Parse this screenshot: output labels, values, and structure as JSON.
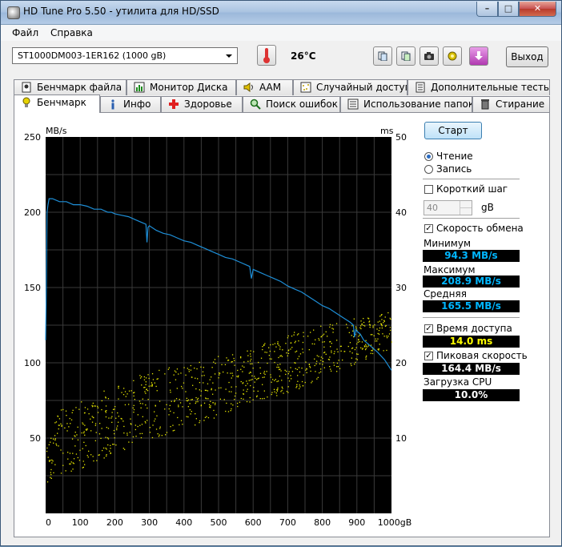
{
  "window": {
    "title": "HD Tune Pro 5.50 - утилита для HD/SSD"
  },
  "menu": [
    {
      "label": "Файл"
    },
    {
      "label": "Справка"
    }
  ],
  "toolbar": {
    "drive": "ST1000DM003-1ER162 (1000 gB)",
    "temperature": "26°C",
    "exit_label": "Выход"
  },
  "tabs_top": [
    {
      "label": "Бенчмарк файла",
      "icon": "file-benchmark-icon"
    },
    {
      "label": "Монитор Диска",
      "icon": "disk-monitor-icon"
    },
    {
      "label": "AAM",
      "icon": "speaker-icon"
    },
    {
      "label": "Случайный доступ",
      "icon": "random-access-icon"
    },
    {
      "label": "Дополнительные  тесты",
      "icon": "extra-tests-icon"
    }
  ],
  "tabs_bottom": [
    {
      "label": "Бенчмарк",
      "icon": "benchmark-icon",
      "active": true
    },
    {
      "label": "Инфо",
      "icon": "info-icon"
    },
    {
      "label": "Здоровье",
      "icon": "health-icon"
    },
    {
      "label": "Поиск ошибок",
      "icon": "error-scan-icon"
    },
    {
      "label": "Использование папок",
      "icon": "folder-usage-icon"
    },
    {
      "label": "Стирание",
      "icon": "erase-icon"
    }
  ],
  "side": {
    "start_label": "Старт",
    "read_label": "Чтение",
    "write_label": "Запись",
    "short_stroke_label": "Короткий шаг",
    "short_stroke_value": "40",
    "short_stroke_unit": "gB",
    "transfer_rate_label": "Скорость обмена",
    "min_label": "Минимум",
    "min_value": "94.3 MB/s",
    "max_label": "Максимум",
    "max_value": "208.9 MB/s",
    "avg_label": "Средняя",
    "avg_value": "165.5 MB/s",
    "access_time_label": "Время доступа",
    "access_time_value": "14.0 ms",
    "burst_label": "Пиковая скорость",
    "burst_value": "164.4 MB/s",
    "cpu_label": "Загрузка CPU",
    "cpu_value": "10.0%"
  },
  "chart_data": {
    "type": "line",
    "y_left_unit": "MB/s",
    "y_right_unit": "ms",
    "y_left_ticks": [
      "50",
      "100",
      "150",
      "200",
      "250"
    ],
    "y_right_ticks": [
      "10",
      "20",
      "30",
      "40",
      "50"
    ],
    "x_ticks": [
      "0",
      "100",
      "200",
      "300",
      "400",
      "500",
      "600",
      "700",
      "800",
      "900",
      "1000gB"
    ],
    "xlim": [
      0,
      1000
    ],
    "ylim_left": [
      0,
      250
    ],
    "ylim_right": [
      0,
      50
    ],
    "colors": {
      "background": "#000000",
      "grid": "#3a3a3a",
      "transfer": "#1e8fd8",
      "access": "#e6e600"
    },
    "series": [
      {
        "kind": "transfer",
        "x": [
          0,
          2,
          4,
          7,
          10,
          20,
          40,
          60,
          80,
          100,
          120,
          140,
          160,
          180,
          190,
          200,
          220,
          240,
          260,
          280,
          290,
          293,
          296,
          300,
          320,
          340,
          360,
          380,
          400,
          420,
          440,
          460,
          480,
          500,
          520,
          540,
          560,
          580,
          590,
          595,
          600,
          620,
          640,
          660,
          680,
          700,
          720,
          740,
          760,
          780,
          800,
          820,
          840,
          860,
          880,
          890,
          893,
          897,
          900,
          910,
          920,
          940,
          960,
          980,
          1000
        ],
        "y": [
          115,
          150,
          200,
          205,
          209,
          209,
          207,
          207,
          205,
          205,
          204,
          202,
          202,
          200,
          200,
          199,
          198,
          197,
          195,
          193,
          192,
          180,
          190,
          191,
          188,
          186,
          185,
          183,
          181,
          180,
          178,
          176,
          174,
          172,
          170,
          169,
          167,
          165,
          164,
          156,
          162,
          160,
          158,
          156,
          154,
          151,
          149,
          147,
          144,
          141,
          138,
          136,
          133,
          130,
          127,
          125,
          117,
          122,
          121,
          119,
          115,
          111,
          107,
          102,
          95
        ]
      },
      {
        "kind": "access",
        "band_low_x": [
          0,
          100,
          200,
          300,
          400,
          500,
          600,
          700,
          800,
          900,
          1000
        ],
        "band_low_y": [
          4,
          6,
          8,
          10,
          11,
          13,
          15,
          16,
          18,
          20,
          22
        ],
        "band_high_y": [
          13,
          15,
          17,
          19,
          20,
          21,
          22,
          24,
          25,
          26,
          27
        ]
      }
    ]
  }
}
